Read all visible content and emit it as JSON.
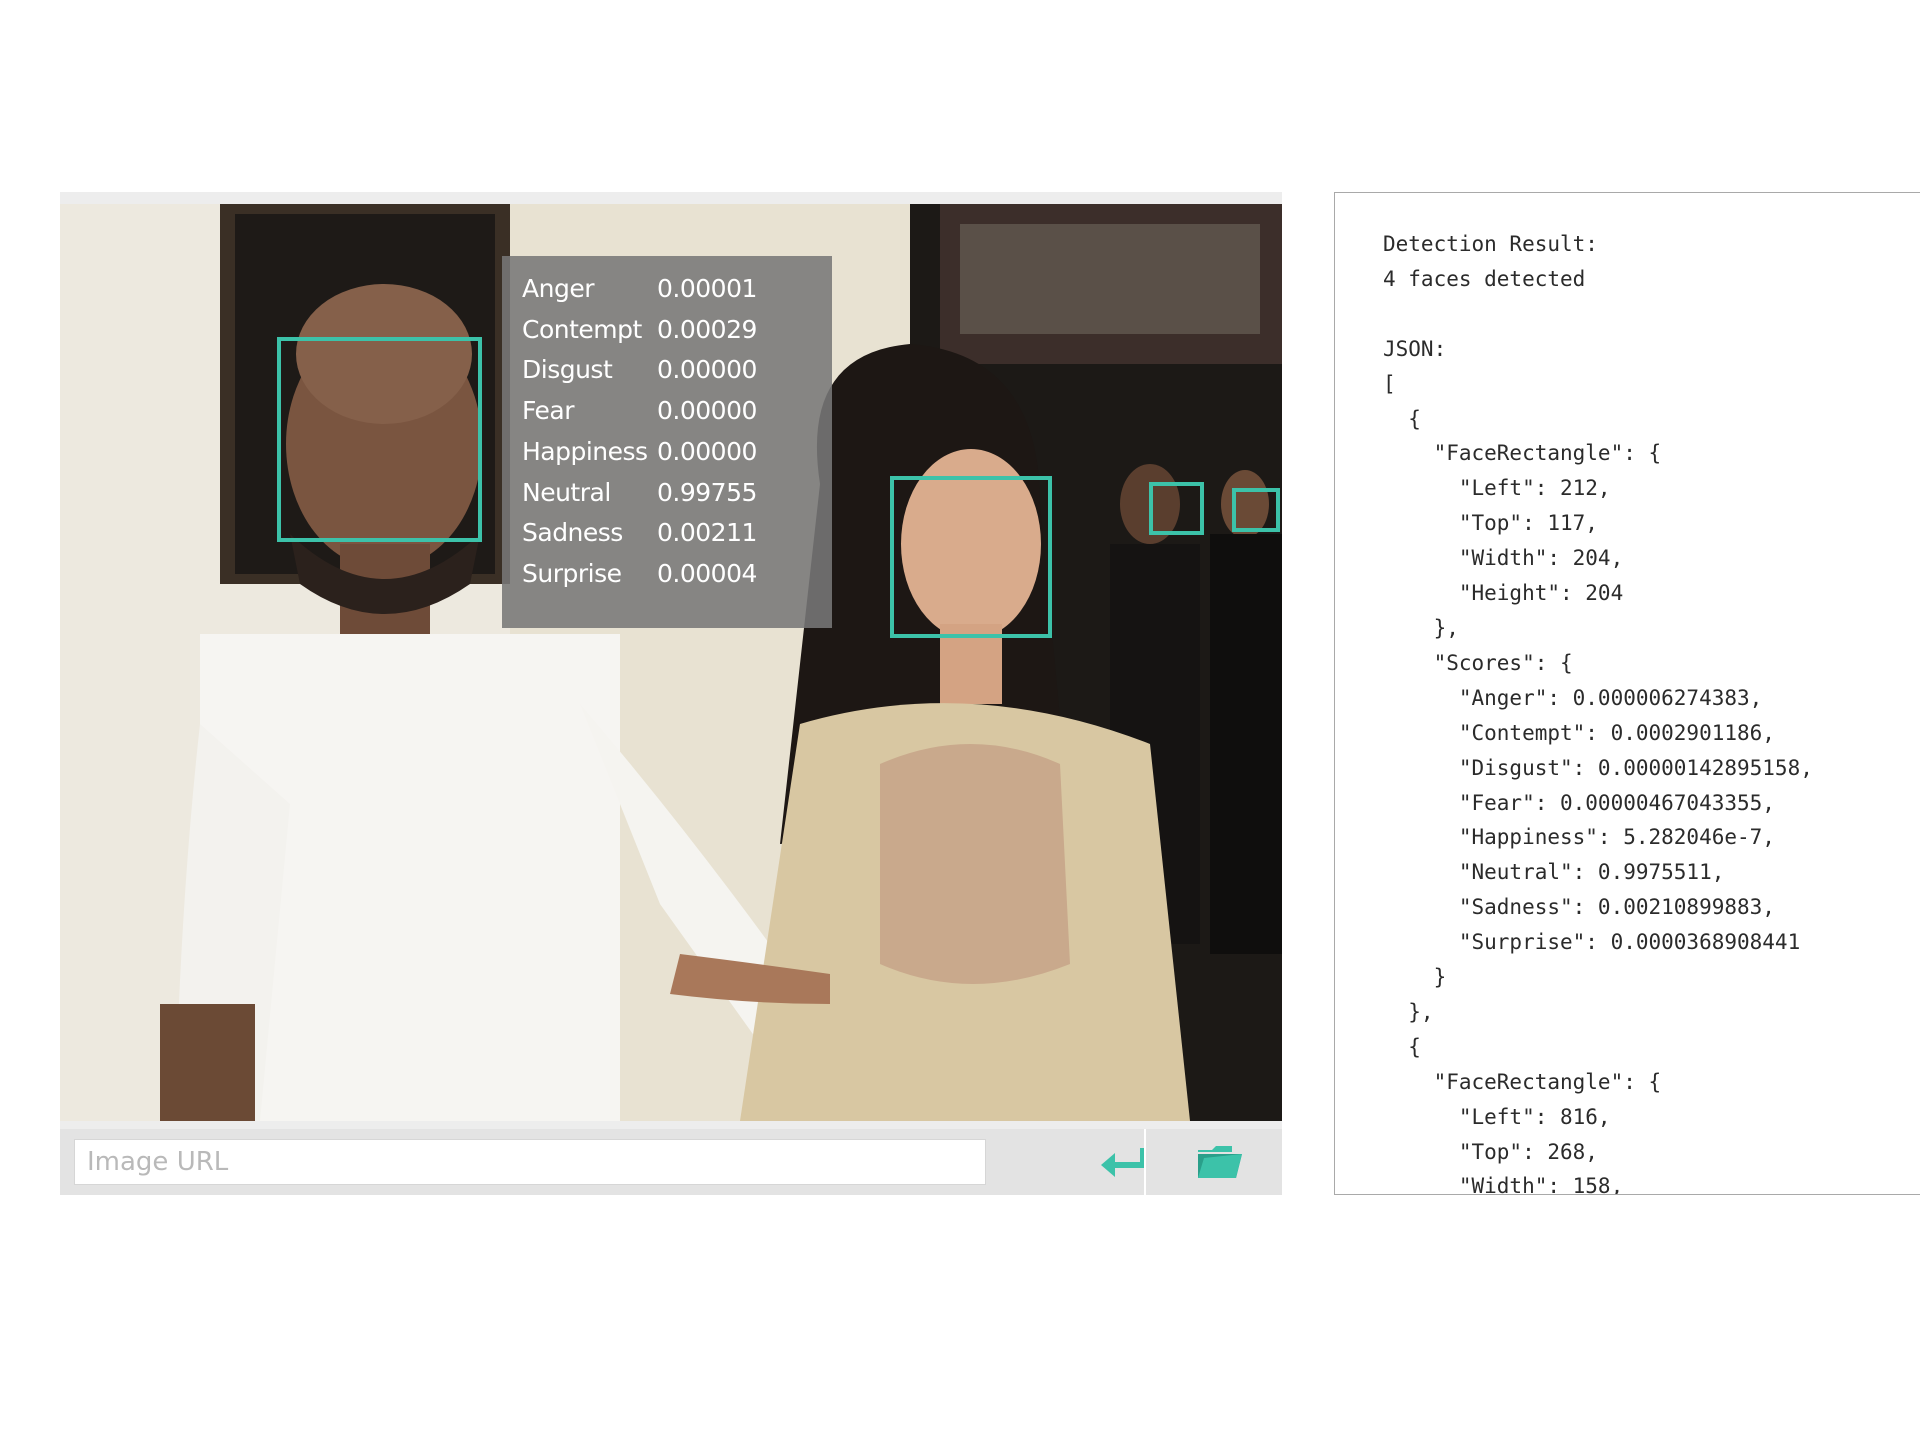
{
  "image": {
    "url_placeholder": "Image URL",
    "faces_overlay": {
      "emotions": [
        {
          "name": "Anger",
          "value": "0.00001"
        },
        {
          "name": "Contempt",
          "value": "0.00029"
        },
        {
          "name": "Disgust",
          "value": "0.00000"
        },
        {
          "name": "Fear",
          "value": "0.00000"
        },
        {
          "name": "Happiness",
          "value": "0.00000"
        },
        {
          "name": "Neutral",
          "value": "0.99755"
        },
        {
          "name": "Sadness",
          "value": "0.00211"
        },
        {
          "name": "Surprise",
          "value": "0.00004"
        }
      ]
    }
  },
  "toolbar": {
    "submit_icon": "enter-arrow-icon",
    "folder_icon": "folder-open-icon"
  },
  "result": {
    "heading": "Detection Result:",
    "summary": "4 faces detected",
    "json_label": "JSON:",
    "json_lines": [
      "[",
      "  {",
      "    \"FaceRectangle\": {",
      "      \"Left\": 212,",
      "      \"Top\": 117,",
      "      \"Width\": 204,",
      "      \"Height\": 204",
      "    },",
      "    \"Scores\": {",
      "      \"Anger\": 0.000006274383,",
      "      \"Contempt\": 0.0002901186,",
      "      \"Disgust\": 0.00000142895158,",
      "      \"Fear\": 0.00000467043355,",
      "      \"Happiness\": 5.282046e-7,",
      "      \"Neutral\": 0.9975511,",
      "      \"Sadness\": 0.00210899883,",
      "      \"Surprise\": 0.0000368908441",
      "    }",
      "  },",
      "  {",
      "    \"FaceRectangle\": {",
      "      \"Left\": 816,",
      "      \"Top\": 268,",
      "      \"Width\": 158,"
    ]
  },
  "colors": {
    "accent": "#3cc2a9",
    "overlay": "#787878",
    "toolbar": "#e3e3e3"
  }
}
